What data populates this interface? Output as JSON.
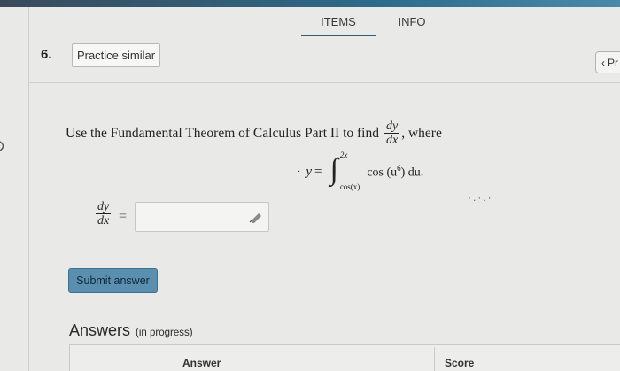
{
  "colors": {
    "background": "#e9e9e7",
    "accent": "#2f5d77",
    "submit": "#5a8fb0"
  },
  "tabs": [
    {
      "label": "ITEMS",
      "active": true
    },
    {
      "label": "INFO",
      "active": false
    }
  ],
  "question": {
    "number": "6.",
    "practice_label": "Practice similar",
    "prev_label": "Pr",
    "text_before": "Use the Fundamental Theorem of Calculus Part II to find",
    "frac_num": "dy",
    "frac_den": "dx",
    "text_after": ", where",
    "equation": {
      "lhs": "y",
      "equals": "=",
      "upper_limit": "2x",
      "lower_limit": "cos(x)",
      "integrand": "cos (u",
      "exponent": "6",
      "tail": ") du."
    }
  },
  "answer": {
    "frac_num": "dy",
    "frac_den": "dx",
    "equals": "=",
    "value": "",
    "icon": "pencil-icon"
  },
  "submit_label": "Submit answer",
  "answers_section": {
    "title": "Answers",
    "subtitle": "(in progress)",
    "columns": [
      "Answer",
      "Score"
    ]
  }
}
